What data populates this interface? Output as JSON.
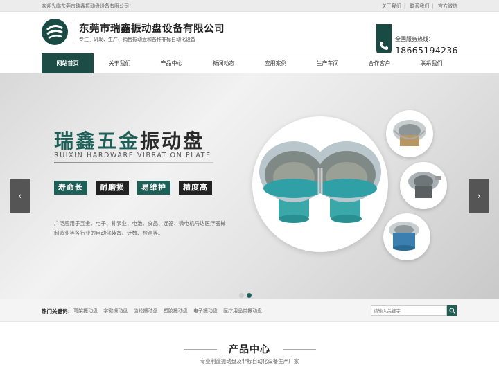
{
  "topbar": {
    "welcome": "欢迎光临东莞市瑞鑫振动盘设备有限公司！",
    "links": [
      "关于我们",
      "联系我们",
      "官方微信"
    ]
  },
  "header": {
    "company": "东莞市瑞鑫振动盘设备有限公司",
    "slogan": "专注于研发、生产、销售振动盘和各种非标自动化设备",
    "phone_label": "全国服务热线：",
    "phone": "18665194236"
  },
  "nav": {
    "items": [
      "网站首页",
      "关于我们",
      "产品中心",
      "新闻动态",
      "应用案例",
      "生产车间",
      "合作客户",
      "联系我们"
    ]
  },
  "banner": {
    "title_part1": "瑞鑫五金",
    "title_part2": "振动盘",
    "subtitle": "RUIXIN HARDWARE VIBRATION PLATE",
    "tags": [
      "寿命长",
      "耐磨损",
      "易维护",
      "精度高"
    ],
    "desc": "广泛应用于五金、电子、钟表业、电池、食品、连器、微电机马达医疗器械制造业等各行业的自动化装备、计数、检测等。",
    "prev": "‹",
    "next": "›"
  },
  "keywords": {
    "title": "热门关键词：",
    "items": [
      "弯架振动盘",
      "字键振动盘",
      "齿轮振动盘",
      "塑胶振动盘",
      "电子振动盘",
      "医疗用品类振动盘"
    ]
  },
  "search": {
    "placeholder": "请输入关键字"
  },
  "products": {
    "title": "产品中心",
    "subtitle": "专业制造振动盘及非标自动化设备生产厂家"
  },
  "colors": {
    "brand": "#1d4c46",
    "accent": "#1e5f58"
  }
}
